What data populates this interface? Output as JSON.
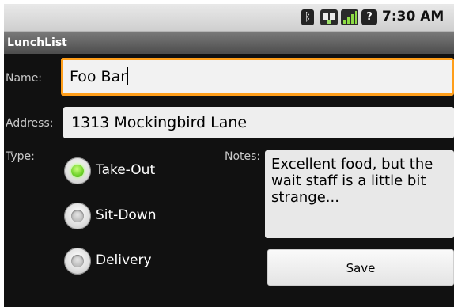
{
  "status_bar": {
    "time": "7:30 AM",
    "icons": [
      "bluetooth-icon",
      "data-signal-icon",
      "cell-signal-icon",
      "alarm-icon"
    ],
    "bluetooth_glyph": "ᛒ",
    "alarm_glyph": "?"
  },
  "app": {
    "title": "LunchList"
  },
  "form": {
    "name_label": "Name:",
    "name_value": "Foo Bar",
    "address_label": "Address:",
    "address_value": "1313 Mockingbird Lane",
    "type_label": "Type:",
    "types": [
      {
        "label": "Take-Out",
        "checked": true
      },
      {
        "label": "Sit-Down",
        "checked": false
      },
      {
        "label": "Delivery",
        "checked": false
      }
    ],
    "notes_label": "Notes:",
    "notes_value": "Excellent food, but the wait staff is a little bit strange...",
    "save_label": "Save"
  },
  "colors": {
    "focus_border": "#ff9e1a",
    "radio_checked": "#6fd22a",
    "background": "#111111"
  }
}
